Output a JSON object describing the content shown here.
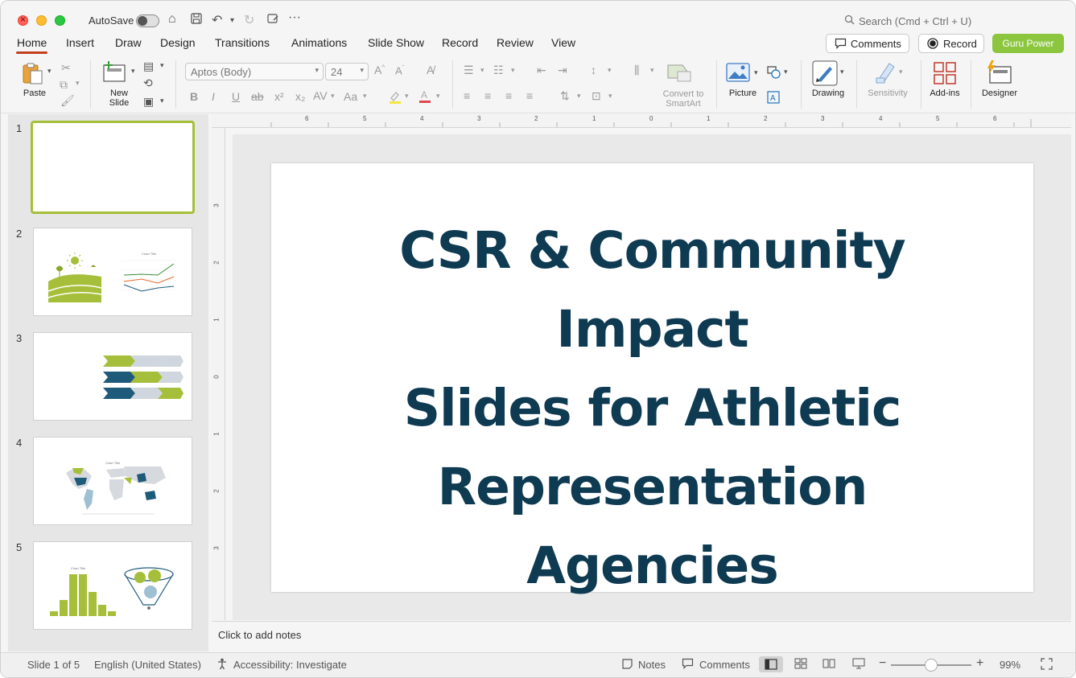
{
  "titlebar": {
    "autosave_label": "AutoSave",
    "search_placeholder": "Search (Cmd + Ctrl + U)"
  },
  "tabs": [
    "Home",
    "Insert",
    "Draw",
    "Design",
    "Transitions",
    "Animations",
    "Slide Show",
    "Record",
    "Review",
    "View"
  ],
  "header_buttons": {
    "comments": "Comments",
    "record": "Record",
    "guru": "Guru Power"
  },
  "ribbon": {
    "paste": "Paste",
    "new_slide": "New Slide",
    "font_name": "Aptos (Body)",
    "font_size": "24",
    "convert_smartart": "Convert to SmartArt",
    "picture": "Picture",
    "drawing": "Drawing",
    "sensitivity": "Sensitivity",
    "addins": "Add-ins",
    "designer": "Designer"
  },
  "slides": [
    {
      "number": "1"
    },
    {
      "number": "2",
      "chart_title": "Chart Title"
    },
    {
      "number": "3"
    },
    {
      "number": "4",
      "chart_title": "Chart Title"
    },
    {
      "number": "5",
      "chart_title": "Chart Title"
    }
  ],
  "current_slide": {
    "title_line1": "CSR & Community Impact",
    "title_line2": "Slides for Athletic",
    "title_line3": "Representation",
    "title_line4": "Agencies"
  },
  "notes_placeholder": "Click to add notes",
  "status": {
    "slide_info": "Slide 1 of 5",
    "language": "English (United States)",
    "accessibility": "Accessibility: Investigate",
    "notes": "Notes",
    "comments": "Comments",
    "zoom": "99%"
  },
  "colors": {
    "title_text": "#0e3a52",
    "accent_green": "#8cc63f",
    "tab_underline": "#c43e1c"
  }
}
